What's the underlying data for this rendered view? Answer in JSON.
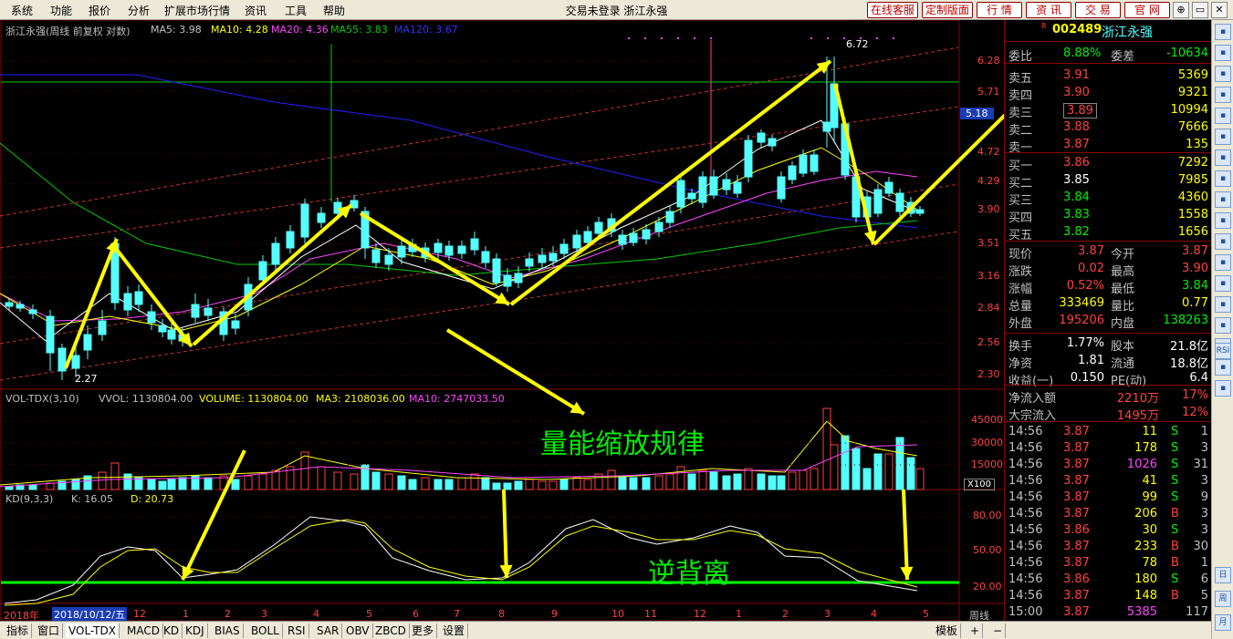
{
  "menu": [
    "系统",
    "功能",
    "报价",
    "分析",
    "扩展市场行情",
    "资讯",
    "工具",
    "帮助"
  ],
  "window_title": "交易未登录   浙江永强",
  "top_buttons": [
    "在线客服",
    "定制版面",
    "行 情",
    "资 讯",
    "交 易",
    "官 网"
  ],
  "chart_header": {
    "title": "浙江永强(周线 前复权 对数)",
    "ma5": "MA5: 3.98",
    "ma10": "MA10: 4.28",
    "ma20": "MA20: 4.36",
    "ma55": "MA55: 3.83",
    "ma120": "MA120: 3.67"
  },
  "colors": {
    "up": "#ff4040",
    "down": "#54ffff",
    "ma5": "#ffffff",
    "ma10": "#ffff00",
    "ma20": "#ff44ff",
    "ma55": "#00cc00",
    "ma120": "#2020ff",
    "arrow": "#ffff00",
    "annot": "#00ff00",
    "axis": "#8b0000"
  },
  "price_axis": [
    "6.28",
    "5.71",
    "5.18",
    "4.72",
    "4.29",
    "3.90",
    "3.51",
    "3.16",
    "2.84",
    "2.56",
    "2.30"
  ],
  "current_price_tag": "5.18",
  "low_label": "2.27",
  "high_label": "6.72",
  "volume_header": {
    "name": "VOL-TDX(3,10)",
    "vvol": "VVOL: 1130804.00",
    "volume": "VOLUME: 1130804.00",
    "ma3": "MA3: 2108036.00",
    "ma10": "MA10: 2747033.50"
  },
  "volume_axis": [
    "45000",
    "30000",
    "15000"
  ],
  "volume_unit": "X100",
  "kd_header": {
    "name": "KD(9,3,3)",
    "k": "K: 16.05",
    "d": "D: 20.73"
  },
  "kd_axis": [
    "80.00",
    "50.00",
    "20.00"
  ],
  "annotations": {
    "volume_rule": "量能缩放规律",
    "divergence": "逆背离"
  },
  "time_axis": {
    "start": "2018年",
    "cursor": "2018/10/12/五",
    "labels": [
      "12",
      "1",
      "2",
      "3",
      "4",
      "5",
      "6",
      "7",
      "8",
      "9",
      "10",
      "11",
      "12",
      "1",
      "2",
      "3",
      "4",
      "5"
    ],
    "period": "周线"
  },
  "quote": {
    "code": "002489",
    "name": "浙江永强",
    "weibi_label": "委比",
    "weibi": "8.88%",
    "weicha_label": "委差",
    "weicha": "-10634",
    "asks": [
      {
        "label": "卖五",
        "price": "3.91",
        "vol": "5369"
      },
      {
        "label": "卖四",
        "price": "3.90",
        "vol": "9321"
      },
      {
        "label": "卖三",
        "price": "3.89",
        "vol": "10994"
      },
      {
        "label": "卖二",
        "price": "3.88",
        "vol": "7666"
      },
      {
        "label": "卖一",
        "price": "3.87",
        "vol": "135"
      }
    ],
    "bids": [
      {
        "label": "买一",
        "price": "3.86",
        "vol": "7292"
      },
      {
        "label": "买二",
        "price": "3.85",
        "vol": "7985"
      },
      {
        "label": "买三",
        "price": "3.84",
        "vol": "4360"
      },
      {
        "label": "买四",
        "price": "3.83",
        "vol": "1558"
      },
      {
        "label": "买五",
        "price": "3.82",
        "vol": "1656"
      }
    ],
    "stats": [
      {
        "l1": "现价",
        "v1": "3.87",
        "l2": "今开",
        "v2": "3.87"
      },
      {
        "l1": "涨跌",
        "v1": "0.02",
        "l2": "最高",
        "v2": "3.90"
      },
      {
        "l1": "涨幅",
        "v1": "0.52%",
        "l2": "最低",
        "v2": "3.84"
      },
      {
        "l1": "总量",
        "v1": "333469",
        "l2": "量比",
        "v2": "0.77"
      },
      {
        "l1": "外盘",
        "v1": "195206",
        "l2": "内盘",
        "v2": "138263"
      }
    ],
    "fund": [
      {
        "l1": "换手",
        "v1": "1.77%",
        "l2": "股本",
        "v2": "21.8亿"
      },
      {
        "l1": "净资",
        "v1": "1.81",
        "l2": "流通",
        "v2": "18.8亿"
      },
      {
        "l1": "收益(一)",
        "v1": "0.150",
        "l2": "PE(动)",
        "v2": "6.4"
      }
    ],
    "flows": [
      {
        "label": "净流入额",
        "value": "2210万",
        "pct": "17%"
      },
      {
        "label": "大宗流入",
        "value": "1495万",
        "pct": "12%"
      }
    ],
    "ticks": [
      {
        "t": "14:56",
        "p": "3.87",
        "v": "11",
        "s": "S",
        "n": "1"
      },
      {
        "t": "14:56",
        "p": "3.87",
        "v": "178",
        "s": "S",
        "n": "3"
      },
      {
        "t": "14:56",
        "p": "3.87",
        "v": "1026",
        "s": "S",
        "n": "31"
      },
      {
        "t": "14:56",
        "p": "3.87",
        "v": "41",
        "s": "S",
        "n": "3"
      },
      {
        "t": "14:56",
        "p": "3.87",
        "v": "99",
        "s": "S",
        "n": "9"
      },
      {
        "t": "14:56",
        "p": "3.87",
        "v": "206",
        "s": "B",
        "n": "3"
      },
      {
        "t": "14:56",
        "p": "3.86",
        "v": "30",
        "s": "S",
        "n": "3"
      },
      {
        "t": "14:56",
        "p": "3.87",
        "v": "233",
        "s": "B",
        "n": "30"
      },
      {
        "t": "14:56",
        "p": "3.87",
        "v": "78",
        "s": "B",
        "n": "1"
      },
      {
        "t": "14:56",
        "p": "3.86",
        "v": "180",
        "s": "S",
        "n": "6"
      },
      {
        "t": "14:56",
        "p": "3.87",
        "v": "148",
        "s": "B",
        "n": "5"
      },
      {
        "t": "15:00",
        "p": "3.87",
        "v": "5385",
        "s": "",
        "n": "117"
      }
    ]
  },
  "bottom_tabs": [
    "指标",
    "窗口",
    "VOL-TDX",
    "MACD",
    "KD",
    "KDJ",
    "BIAS",
    "BOLL",
    "RSI",
    "SAR",
    "OBV",
    "ZBCD",
    "更多",
    "设置"
  ],
  "bottom_right": [
    "模板",
    "+",
    "−"
  ],
  "right_toolbar": [
    "RSI",
    "日",
    "周",
    "月"
  ]
}
